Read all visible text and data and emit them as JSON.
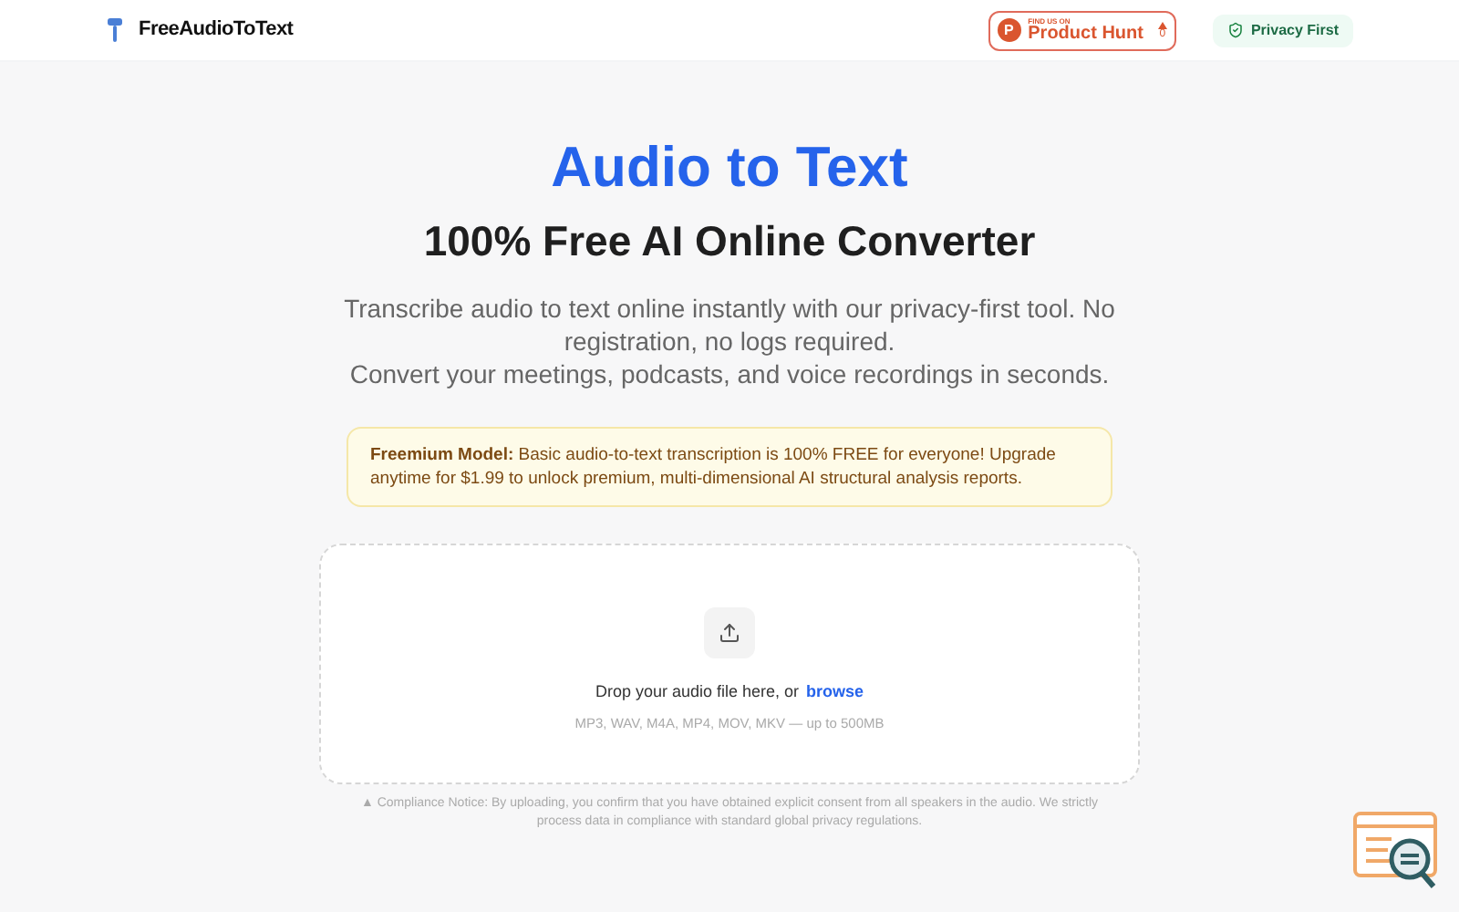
{
  "header": {
    "brand": "FreeAudioToText",
    "product_hunt": {
      "kicker": "FIND US ON",
      "name": "Product Hunt",
      "logo": "P",
      "votes": "0"
    },
    "privacy_badge": "Privacy First"
  },
  "hero": {
    "title": "Audio to Text",
    "subtitle": "100% Free AI Online Converter",
    "description_lines": [
      "Transcribe audio to text online instantly with our privacy-first tool. No registration, no logs required.",
      "Convert your meetings, podcasts, and voice recordings in seconds."
    ]
  },
  "notice": {
    "text": "**Freemium Model:** Basic audio-to-text transcription is 100% FREE for everyone! Upgrade anytime for $1.99 to unlock premium, multi-dimensional AI structural analysis reports."
  },
  "dropzone": {
    "prompt": "Drop your audio file here, or",
    "link": "browse",
    "formats": "MP3, WAV, M4A, MP4, MOV, MKV — up to 500MB"
  },
  "compliance": "▲ Compliance Notice: By uploading, you confirm that you have obtained explicit consent from all speakers in the audio. We strictly process data in compliance with standard global privacy regulations."
}
